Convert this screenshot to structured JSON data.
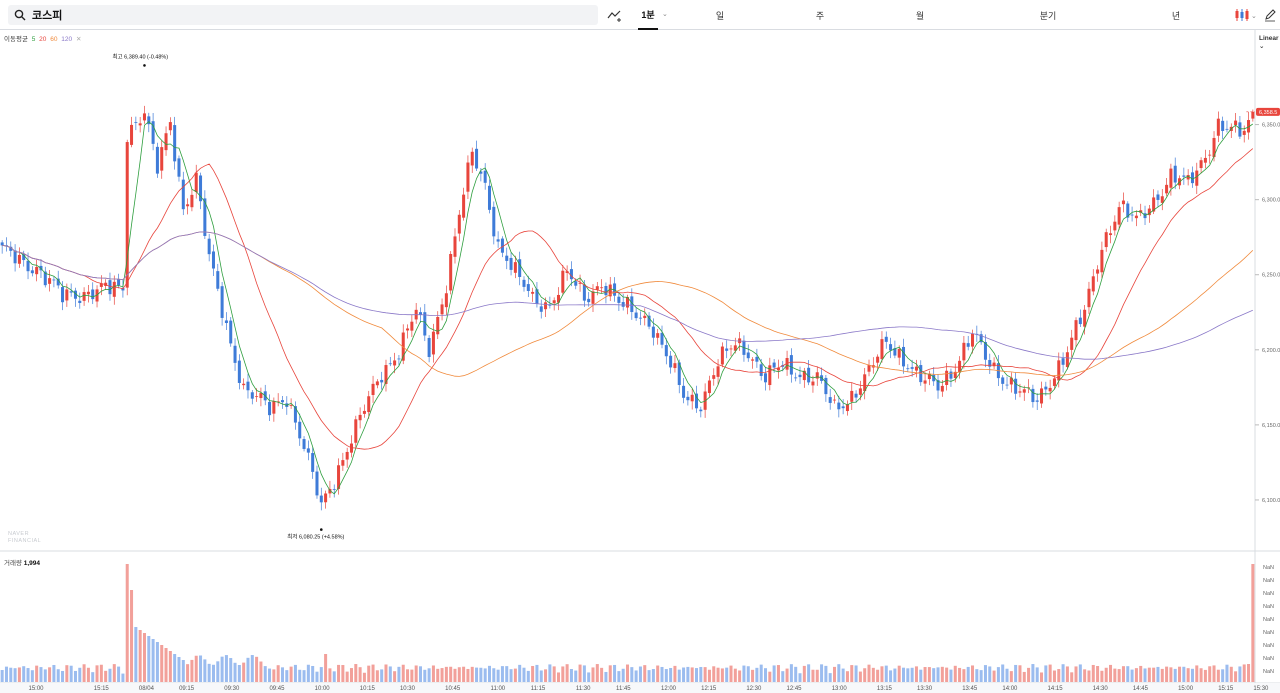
{
  "toolbar": {
    "search_value": "코스피",
    "chart_type_icon": "line-chart-add-icon",
    "tabs": [
      {
        "label": "1분",
        "active": true
      },
      {
        "label": "일",
        "active": false
      },
      {
        "label": "주",
        "active": false
      },
      {
        "label": "월",
        "active": false
      },
      {
        "label": "분기",
        "active": false
      },
      {
        "label": "년",
        "active": false
      }
    ],
    "candle_icon": "candlestick-icon",
    "draw_icon": "pencil-icon"
  },
  "legend": {
    "ma_title": "이동평균",
    "ma_periods": [
      "5",
      "20",
      "60",
      "120"
    ],
    "ma_colors": [
      "#2e9e3e",
      "#e8453c",
      "#f08a3c",
      "#8a78c8"
    ],
    "volume_title": "거래량",
    "volume_value": "1,994",
    "scale_mode": "Linear"
  },
  "watermark": [
    "NAVER",
    "FINANCIAL"
  ],
  "colors": {
    "up": "#e8453c",
    "down": "#3e7bd8",
    "volume_up": "#f2a09a",
    "volume_down": "#9bbcef",
    "price_tag": "#e8453c"
  },
  "annotations": {
    "high": {
      "label": "최고",
      "value": "6,389.40 (-0.48%)"
    },
    "low": {
      "label": "최저",
      "value": "6,080.25 (+4.58%)"
    },
    "last_price": "6,358.5"
  },
  "chart_data": {
    "type": "candlestick",
    "x_ticks": [
      "15:00",
      "15:15",
      "08/04",
      "09:15",
      "09:30",
      "09:45",
      "10:00",
      "10:15",
      "10:30",
      "10:45",
      "11:00",
      "11:15",
      "11:30",
      "11:45",
      "12:00",
      "12:15",
      "12:30",
      "12:45",
      "13:00",
      "13:15",
      "13:30",
      "13:45",
      "14:00",
      "14:15",
      "14:30",
      "14:45",
      "15:00",
      "15:15",
      "15:30"
    ],
    "y_ticks": [
      "6,350.0",
      "6,300.0",
      "6,250.0",
      "6,200.0",
      "6,150.0",
      "6,100.0"
    ],
    "ylim": [
      6070,
      6405
    ],
    "volume_axis_labels": [
      "NaN",
      "NaN",
      "NaN",
      "NaN",
      "NaN",
      "NaN",
      "NaN",
      "NaN",
      "NaN"
    ],
    "price_anchors": [
      [
        0,
        6265
      ],
      [
        8,
        6255
      ],
      [
        14,
        6235
      ],
      [
        22,
        6240
      ],
      [
        28,
        6240
      ],
      [
        29,
        6345
      ],
      [
        33,
        6360
      ],
      [
        36,
        6320
      ],
      [
        39,
        6350
      ],
      [
        42,
        6295
      ],
      [
        45,
        6315
      ],
      [
        48,
        6260
      ],
      [
        52,
        6215
      ],
      [
        56,
        6175
      ],
      [
        62,
        6160
      ],
      [
        66,
        6170
      ],
      [
        70,
        6135
      ],
      [
        74,
        6095
      ],
      [
        77,
        6115
      ],
      [
        80,
        6135
      ],
      [
        84,
        6160
      ],
      [
        88,
        6185
      ],
      [
        92,
        6200
      ],
      [
        96,
        6225
      ],
      [
        99,
        6200
      ],
      [
        103,
        6245
      ],
      [
        106,
        6290
      ],
      [
        109,
        6330
      ],
      [
        112,
        6310
      ],
      [
        115,
        6270
      ],
      [
        119,
        6250
      ],
      [
        123,
        6235
      ],
      [
        127,
        6230
      ],
      [
        131,
        6250
      ],
      [
        135,
        6235
      ],
      [
        139,
        6245
      ],
      [
        143,
        6230
      ],
      [
        147,
        6225
      ],
      [
        150,
        6220
      ],
      [
        154,
        6195
      ],
      [
        158,
        6170
      ],
      [
        162,
        6165
      ],
      [
        166,
        6190
      ],
      [
        170,
        6205
      ],
      [
        173,
        6200
      ],
      [
        177,
        6180
      ],
      [
        181,
        6190
      ],
      [
        185,
        6185
      ],
      [
        189,
        6180
      ],
      [
        193,
        6160
      ],
      [
        197,
        6170
      ],
      [
        201,
        6185
      ],
      [
        205,
        6205
      ],
      [
        209,
        6195
      ],
      [
        213,
        6180
      ],
      [
        217,
        6175
      ],
      [
        221,
        6190
      ],
      [
        225,
        6210
      ],
      [
        229,
        6190
      ],
      [
        233,
        6180
      ],
      [
        237,
        6170
      ],
      [
        240,
        6165
      ],
      [
        243,
        6180
      ],
      [
        247,
        6200
      ],
      [
        251,
        6225
      ],
      [
        255,
        6270
      ],
      [
        259,
        6295
      ],
      [
        263,
        6285
      ],
      [
        267,
        6300
      ],
      [
        271,
        6315
      ],
      [
        275,
        6310
      ],
      [
        279,
        6330
      ],
      [
        282,
        6350
      ],
      [
        285,
        6345
      ],
      [
        288,
        6345
      ],
      [
        290,
        6358
      ]
    ],
    "moving_averages": [
      {
        "name": "5",
        "color": "#2e9e3e"
      },
      {
        "name": "20",
        "color": "#e8453c"
      },
      {
        "name": "60",
        "color": "#f08a3c"
      },
      {
        "name": "120",
        "color": "#8a78c8"
      }
    ],
    "high": 6389.4,
    "low": 6080.25,
    "last": 6358.5,
    "volume_description": "large spikes at session open and close, moderate elsewhere",
    "xlabel": "",
    "ylabel": "",
    "title": ""
  }
}
